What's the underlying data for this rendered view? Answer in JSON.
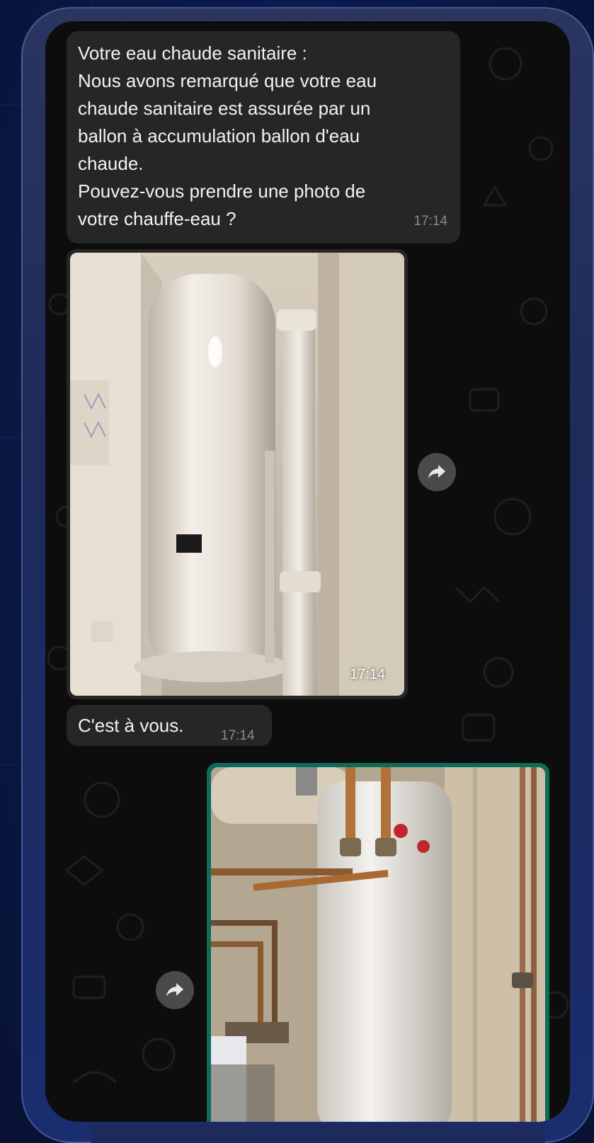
{
  "conversation": {
    "message1": {
      "lines": [
        "Votre eau chaude sanitaire :",
        "Nous avons remarqué que votre eau",
        "chaude sanitaire est assurée par un",
        "ballon à accumulation ballon d'eau",
        "chaude.",
        "Pouvez-vous prendre une photo de",
        "votre chauffe-eau ?"
      ],
      "time": "17:14"
    },
    "photo1": {
      "time": "17:14"
    },
    "message2": {
      "text": "C'est à vous.",
      "time": "17:14"
    }
  },
  "colors": {
    "incoming_bubble": "#262626",
    "chat_background": "#0d0d0d",
    "outgoing_border": "#0e6b5a",
    "forward_button": "#4a4a4a"
  },
  "icons": [
    "forward-icon"
  ]
}
